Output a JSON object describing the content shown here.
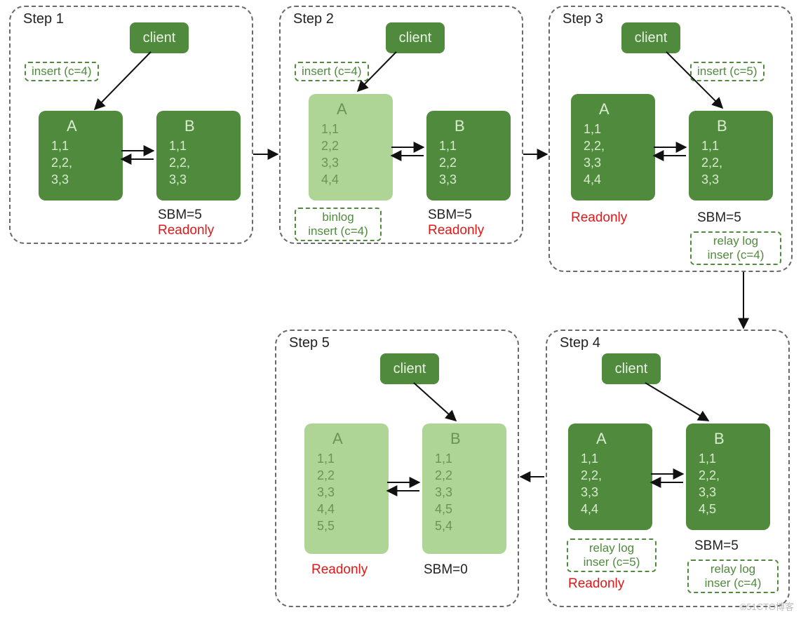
{
  "watermark": "©51CTO博客",
  "steps": {
    "s1": {
      "title": "Step 1",
      "client": "client",
      "op": "insert (c=4)",
      "a": {
        "title": "A",
        "rows": [
          "1,1",
          "2,2,",
          "3,3"
        ]
      },
      "b": {
        "title": "B",
        "rows": [
          "1,1",
          "2,2,",
          "3,3"
        ]
      },
      "sbm": "SBM=5",
      "ro": "Readonly"
    },
    "s2": {
      "title": "Step 2",
      "client": "client",
      "op": "insert (c=4)",
      "a": {
        "title": "A",
        "rows": [
          "1,1",
          "2,2",
          "3,3",
          "4,4"
        ]
      },
      "b": {
        "title": "B",
        "rows": [
          "1,1",
          "2,2",
          "3,3"
        ]
      },
      "binlog_l1": "binlog",
      "binlog_l2": "insert (c=4)",
      "sbm": "SBM=5",
      "ro": "Readonly"
    },
    "s3": {
      "title": "Step 3",
      "client": "client",
      "op": "insert (c=5)",
      "a": {
        "title": "A",
        "rows": [
          "1,1",
          "2,2,",
          "3,3",
          "4,4"
        ]
      },
      "b": {
        "title": "B",
        "rows": [
          "1,1",
          "2,2,",
          "3,3"
        ]
      },
      "sbm": "SBM=5",
      "ro": "Readonly",
      "relay_l1": "relay log",
      "relay_l2": "inser (c=4)"
    },
    "s4": {
      "title": "Step 4",
      "client": "client",
      "a": {
        "title": "A",
        "rows": [
          "1,1",
          "2,2,",
          "3,3",
          "4,4"
        ]
      },
      "b": {
        "title": "B",
        "rows": [
          "1,1",
          "2,2,",
          "3,3",
          "4,5"
        ]
      },
      "sbm": "SBM=5",
      "ro": "Readonly",
      "relayA_l1": "relay log",
      "relayA_l2": "inser (c=5)",
      "relayB_l1": "relay log",
      "relayB_l2": "inser (c=4)"
    },
    "s5": {
      "title": "Step 5",
      "client": "client",
      "a": {
        "title": "A",
        "rows": [
          "1,1",
          "2,2",
          "3,3",
          "4,4",
          "5,5"
        ]
      },
      "b": {
        "title": "B",
        "rows": [
          "1,1",
          "2,2",
          "3,3",
          "4,5",
          "5,4"
        ]
      },
      "sbm": "SBM=0",
      "ro": "Readonly"
    }
  },
  "chart_data": {
    "type": "diagram",
    "title": "MySQL replication steps",
    "steps": [
      {
        "step": 1,
        "client_op": "insert (c=4)",
        "A": [
          "1,1",
          "2,2",
          "3,3"
        ],
        "B": [
          "1,1",
          "2,2",
          "3,3"
        ],
        "SBM": 5,
        "B_readonly": true
      },
      {
        "step": 2,
        "client_op": "insert (c=4)",
        "A": [
          "1,1",
          "2,2",
          "3,3",
          "4,4"
        ],
        "B": [
          "1,1",
          "2,2",
          "3,3"
        ],
        "binlog_A": "insert (c=4)",
        "SBM": 5,
        "B_readonly": true
      },
      {
        "step": 3,
        "client_op": "insert (c=5)",
        "A": [
          "1,1",
          "2,2",
          "3,3",
          "4,4"
        ],
        "B": [
          "1,1",
          "2,2",
          "3,3"
        ],
        "relaylog_B": "inser (c=4)",
        "SBM": 5,
        "A_readonly": true
      },
      {
        "step": 4,
        "A": [
          "1,1",
          "2,2",
          "3,3",
          "4,4"
        ],
        "B": [
          "1,1",
          "2,2",
          "3,3",
          "4,5"
        ],
        "relaylog_A": "inser (c=5)",
        "relaylog_B": "inser (c=4)",
        "SBM": 5,
        "A_readonly": true
      },
      {
        "step": 5,
        "A": [
          "1,1",
          "2,2",
          "3,3",
          "4,4",
          "5,5"
        ],
        "B": [
          "1,1",
          "2,2",
          "3,3",
          "4,5",
          "5,4"
        ],
        "SBM": 0,
        "A_readonly": true
      }
    ],
    "flow_order": [
      1,
      2,
      3,
      4,
      5
    ]
  }
}
